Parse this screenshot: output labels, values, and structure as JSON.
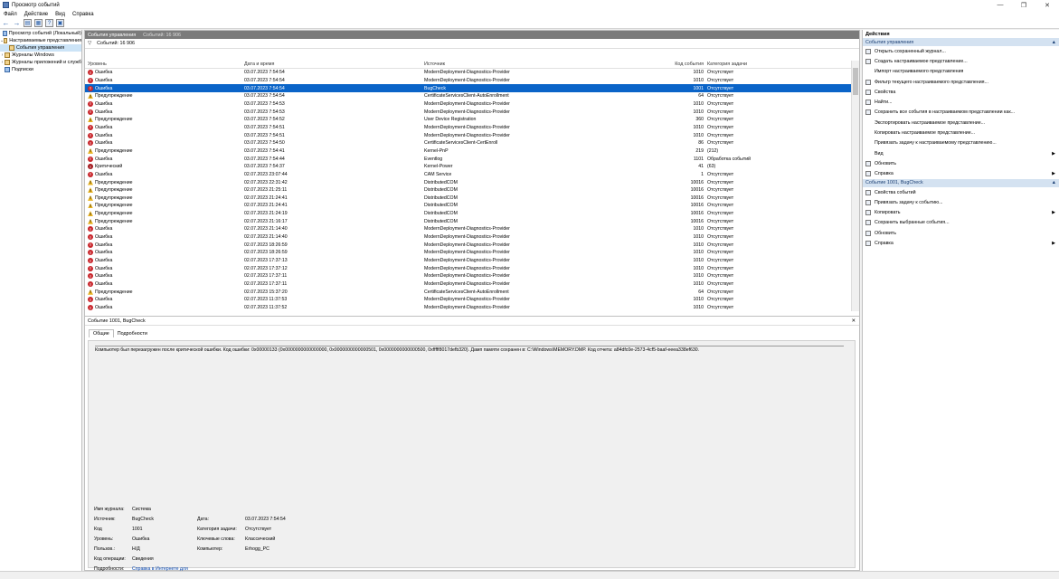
{
  "window": {
    "title": "Просмотр событий",
    "min": "—",
    "max": "❐",
    "close": "✕"
  },
  "menu": [
    "Файл",
    "Действие",
    "Вид",
    "Справка"
  ],
  "toolbar_icons": [
    "back-icon",
    "forward-icon",
    "folder-icon",
    "properties-icon",
    "help-icon",
    "view-icon"
  ],
  "tree": {
    "root": "Просмотр событий (Локальный)",
    "custom_views": "Настраиваемые представления",
    "admin_events": "События управления",
    "windows_logs": "Журналы Windows",
    "app_logs": "Журналы приложений и служб",
    "subscriptions": "Подписки"
  },
  "center": {
    "header_title": "События управления",
    "header_count": "Событий: 16 906",
    "filter_text": "Событий: 16 906",
    "columns": {
      "level": "Уровень",
      "date": "Дата и время",
      "source": "Источник",
      "id": "Код события",
      "category": "Категория задачи"
    }
  },
  "events": [
    {
      "level": "Ошибка",
      "kind": "err",
      "date": "03.07.2023 7:54:54",
      "source": "ModernDeployment-Diagnostics-Provider",
      "id": "1010",
      "cat": "Отсутствует"
    },
    {
      "level": "Ошибка",
      "kind": "err",
      "date": "03.07.2023 7:54:54",
      "source": "ModernDeployment-Diagnostics-Provider",
      "id": "1010",
      "cat": "Отсутствует"
    },
    {
      "level": "Ошибка",
      "kind": "err",
      "date": "03.07.2023 7:54:54",
      "source": "BugCheck",
      "id": "1001",
      "cat": "Отсутствует",
      "selected": true
    },
    {
      "level": "Предупреждение",
      "kind": "warn",
      "date": "03.07.2023 7:54:54",
      "source": "CertificateServicesClient-AutoEnrollment",
      "id": "64",
      "cat": "Отсутствует"
    },
    {
      "level": "Ошибка",
      "kind": "err",
      "date": "03.07.2023 7:54:53",
      "source": "ModernDeployment-Diagnostics-Provider",
      "id": "1010",
      "cat": "Отсутствует"
    },
    {
      "level": "Ошибка",
      "kind": "err",
      "date": "03.07.2023 7:54:53",
      "source": "ModernDeployment-Diagnostics-Provider",
      "id": "1010",
      "cat": "Отсутствует"
    },
    {
      "level": "Предупреждение",
      "kind": "warn",
      "date": "03.07.2023 7:54:52",
      "source": "User Device Registration",
      "id": "360",
      "cat": "Отсутствует"
    },
    {
      "level": "Ошибка",
      "kind": "err",
      "date": "03.07.2023 7:54:51",
      "source": "ModernDeployment-Diagnostics-Provider",
      "id": "1010",
      "cat": "Отсутствует"
    },
    {
      "level": "Ошибка",
      "kind": "err",
      "date": "03.07.2023 7:54:51",
      "source": "ModernDeployment-Diagnostics-Provider",
      "id": "1010",
      "cat": "Отсутствует"
    },
    {
      "level": "Ошибка",
      "kind": "err",
      "date": "03.07.2023 7:54:50",
      "source": "CertificateServicesClient-CertEnroll",
      "id": "86",
      "cat": "Отсутствует"
    },
    {
      "level": "Предупреждение",
      "kind": "warn",
      "date": "03.07.2023 7:54:41",
      "source": "Kernel-PnP",
      "id": "219",
      "cat": "(212)"
    },
    {
      "level": "Ошибка",
      "kind": "err",
      "date": "03.07.2023 7:54:44",
      "source": "Eventlog",
      "id": "1101",
      "cat": "Обработка событий"
    },
    {
      "level": "Критический",
      "kind": "crit",
      "date": "03.07.2023 7:54:37",
      "source": "Kernel-Power",
      "id": "41",
      "cat": "(63)"
    },
    {
      "level": "Ошибка",
      "kind": "err",
      "date": "02.07.2023 23:07:44",
      "source": "CAM Service",
      "id": "1",
      "cat": "Отсутствует"
    },
    {
      "level": "Предупреждение",
      "kind": "warn",
      "date": "02.07.2023 22:31:42",
      "source": "DistributedCOM",
      "id": "10016",
      "cat": "Отсутствует"
    },
    {
      "level": "Предупреждение",
      "kind": "warn",
      "date": "02.07.2023 21:25:11",
      "source": "DistributedCOM",
      "id": "10016",
      "cat": "Отсутствует"
    },
    {
      "level": "Предупреждение",
      "kind": "warn",
      "date": "02.07.2023 21:24:41",
      "source": "DistributedCOM",
      "id": "10016",
      "cat": "Отсутствует"
    },
    {
      "level": "Предупреждение",
      "kind": "warn",
      "date": "02.07.2023 21:24:41",
      "source": "DistributedCOM",
      "id": "10016",
      "cat": "Отсутствует"
    },
    {
      "level": "Предупреждение",
      "kind": "warn",
      "date": "02.07.2023 21:24:19",
      "source": "DistributedCOM",
      "id": "10016",
      "cat": "Отсутствует"
    },
    {
      "level": "Предупреждение",
      "kind": "warn",
      "date": "02.07.2023 21:16:17",
      "source": "DistributedCOM",
      "id": "10016",
      "cat": "Отсутствует"
    },
    {
      "level": "Ошибка",
      "kind": "err",
      "date": "02.07.2023 21:14:40",
      "source": "ModernDeployment-Diagnostics-Provider",
      "id": "1010",
      "cat": "Отсутствует"
    },
    {
      "level": "Ошибка",
      "kind": "err",
      "date": "02.07.2023 21:14:40",
      "source": "ModernDeployment-Diagnostics-Provider",
      "id": "1010",
      "cat": "Отсутствует"
    },
    {
      "level": "Ошибка",
      "kind": "err",
      "date": "02.07.2023 18:26:59",
      "source": "ModernDeployment-Diagnostics-Provider",
      "id": "1010",
      "cat": "Отсутствует"
    },
    {
      "level": "Ошибка",
      "kind": "err",
      "date": "02.07.2023 18:26:59",
      "source": "ModernDeployment-Diagnostics-Provider",
      "id": "1010",
      "cat": "Отсутствует"
    },
    {
      "level": "Ошибка",
      "kind": "err",
      "date": "02.07.2023 17:37:13",
      "source": "ModernDeployment-Diagnostics-Provider",
      "id": "1010",
      "cat": "Отсутствует"
    },
    {
      "level": "Ошибка",
      "kind": "err",
      "date": "02.07.2023 17:37:12",
      "source": "ModernDeployment-Diagnostics-Provider",
      "id": "1010",
      "cat": "Отсутствует"
    },
    {
      "level": "Ошибка",
      "kind": "err",
      "date": "02.07.2023 17:37:11",
      "source": "ModernDeployment-Diagnostics-Provider",
      "id": "1010",
      "cat": "Отсутствует"
    },
    {
      "level": "Ошибка",
      "kind": "err",
      "date": "02.07.2023 17:37:11",
      "source": "ModernDeployment-Diagnostics-Provider",
      "id": "1010",
      "cat": "Отсутствует"
    },
    {
      "level": "Предупреждение",
      "kind": "warn",
      "date": "02.07.2023 15:37:20",
      "source": "CertificateServicesClient-AutoEnrollment",
      "id": "64",
      "cat": "Отсутствует"
    },
    {
      "level": "Ошибка",
      "kind": "err",
      "date": "02.07.2023 11:37:53",
      "source": "ModernDeployment-Diagnostics-Provider",
      "id": "1010",
      "cat": "Отсутствует"
    },
    {
      "level": "Ошибка",
      "kind": "err",
      "date": "02.07.2023 11:37:52",
      "source": "ModernDeployment-Diagnostics-Provider",
      "id": "1010",
      "cat": "Отсутствует"
    }
  ],
  "details": {
    "title": "Событие 1001, BugCheck",
    "close": "✕",
    "tab_general": "Общие",
    "tab_details": "Подробности",
    "message": "Компьютер был перезагружен после критической ошибки.  Код ошибки: 0x00000133 (0x0000000000000000, 0x0000000000000501, 0x0000000000000500, 0xfffff8017defb320). Дамп памяти сохранен в: C:\\Windows\\MEMORY.DMP. Код отчета: a84dfc0e-2573-4cf5-baaf-eeea338ef630.",
    "log_name_label": "Имя журнала:",
    "log_name": "Система",
    "source_label": "Источник:",
    "source": "BugCheck",
    "date_label": "Дата:",
    "date": "03.07.2023 7:54:54",
    "code_label": "Код",
    "code": "1001",
    "task_label": "Категория задачи:",
    "task": "Отсутствует",
    "level_label": "Уровень:",
    "level": "Ошибка",
    "keywords_label": "Ключевые слова:",
    "keywords": "Классический",
    "user_label": "Пользов.:",
    "user": "Н/Д",
    "computer_label": "Компьютер:",
    "computer": "Erhogg_PC",
    "opcode_label": "Код операции:",
    "opcode": "Сведения",
    "more_label": "Подробности:",
    "more_link": "Справка в Интернете для"
  },
  "actions": {
    "header": "Действия",
    "section1": "События управления",
    "items1": [
      {
        "label": "Открыть сохраненный журнал...",
        "icon": "folder-icon"
      },
      {
        "label": "Создать настраиваемое представление...",
        "icon": "filter-icon"
      },
      {
        "label": "Импорт настраиваемого представления",
        "icon": ""
      },
      {
        "label": "Фильтр текущего настраиваемого представления...",
        "icon": "filter-icon"
      },
      {
        "label": "Свойства",
        "icon": "properties-icon"
      },
      {
        "label": "Найти...",
        "icon": "find-icon"
      },
      {
        "label": "Сохранить все события в настраиваемом представлении как...",
        "icon": "save-icon"
      },
      {
        "label": "Экспортировать настраиваемое представление...",
        "icon": ""
      },
      {
        "label": "Копировать настраиваемое представление...",
        "icon": ""
      },
      {
        "label": "Привязать задачу к настраиваемому представлению...",
        "icon": ""
      },
      {
        "label": "Вид",
        "icon": "",
        "arrow": true
      },
      {
        "label": "Обновить",
        "icon": "refresh-icon"
      },
      {
        "label": "Справка",
        "icon": "help-icon",
        "arrow": true
      }
    ],
    "section2": "Событие 1001, BugCheck",
    "items2": [
      {
        "label": "Свойства событий",
        "icon": "properties-icon"
      },
      {
        "label": "Привязать задачу к событию...",
        "icon": "task-icon"
      },
      {
        "label": "Копировать",
        "icon": "copy-icon",
        "arrow": true
      },
      {
        "label": "Сохранить выбранные события...",
        "icon": "save-icon"
      },
      {
        "label": "Обновить",
        "icon": "refresh-icon"
      },
      {
        "label": "Справка",
        "icon": "help-icon",
        "arrow": true
      }
    ]
  }
}
